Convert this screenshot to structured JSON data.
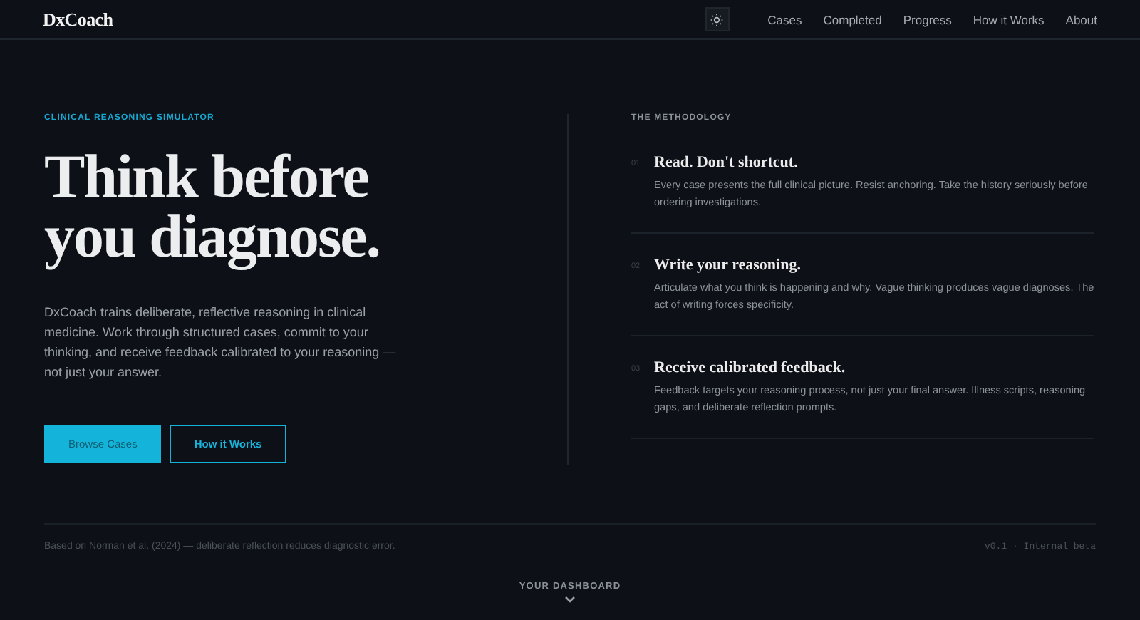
{
  "nav": {
    "logo": "DxCoach",
    "links": [
      "Cases",
      "Completed",
      "Progress",
      "How it Works",
      "About"
    ]
  },
  "hero": {
    "eyebrow": "CLINICAL REASONING SIMULATOR",
    "title_lines": [
      "Think before",
      "you diagnose."
    ],
    "intro": "DxCoach trains deliberate, reflective reasoning in clinical medicine. Work through structured cases, commit to your thinking, and receive feedback calibrated to your reasoning — not just your answer.",
    "buttons": [
      {
        "label": "Browse Cases",
        "kind": "primary"
      },
      {
        "label": "How it Works",
        "kind": "outline"
      }
    ]
  },
  "methodology": {
    "heading": "THE METHODOLOGY",
    "steps": [
      {
        "number": "01",
        "title": "Read. Don't shortcut.",
        "text": "Every case presents the full clinical picture. Resist anchoring. Take the history seriously before ordering investigations."
      },
      {
        "number": "02",
        "title": "Write your reasoning.",
        "text": "Articulate what you think is happening and why. Vague thinking produces vague diagnoses. The act of writing forces specificity."
      },
      {
        "number": "03",
        "title": "Receive calibrated feedback.",
        "text": "Feedback targets your reasoning process, not just your final answer. Illness scripts, reasoning gaps, and deliberate reflection prompts."
      }
    ]
  },
  "footer": {
    "citation": "Based on Norman et al. (2024) — deliberate reflection reduces diagnostic error.",
    "version": "v0.1 · Internal beta"
  },
  "dashboard": {
    "label": "YOUR DASHBOARD"
  }
}
